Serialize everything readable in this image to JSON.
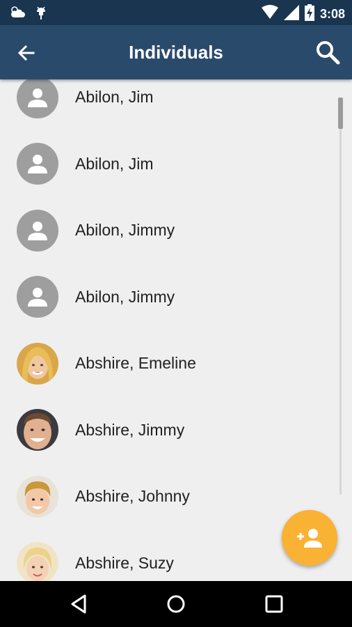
{
  "status_bar": {
    "time": "3:08",
    "left_icons": [
      "weather-cloud-icon",
      "android-debug-icon"
    ],
    "right_icons": [
      "wifi-icon",
      "cell-signal-icon",
      "battery-charging-icon"
    ]
  },
  "app_bar": {
    "title": "Individuals",
    "back_icon": "arrow-back-icon",
    "search_icon": "search-icon",
    "color": "#2a4a6b"
  },
  "individuals": [
    {
      "name": "Abilon, Jim",
      "avatar": "placeholder"
    },
    {
      "name": "Abilon, Jim",
      "avatar": "placeholder"
    },
    {
      "name": "Abilon, Jimmy",
      "avatar": "placeholder"
    },
    {
      "name": "Abilon, Jimmy",
      "avatar": "placeholder"
    },
    {
      "name": "Abshire, Emeline",
      "avatar": "photo"
    },
    {
      "name": "Abshire, Jimmy",
      "avatar": "photo"
    },
    {
      "name": "Abshire, Johnny",
      "avatar": "photo"
    },
    {
      "name": "Abshire, Suzy",
      "avatar": "photo"
    }
  ],
  "fab": {
    "icon": "add-person-icon",
    "color": "#f9b233"
  },
  "nav_bar": {
    "icons": [
      "nav-back-icon",
      "nav-home-icon",
      "nav-recents-icon"
    ]
  }
}
